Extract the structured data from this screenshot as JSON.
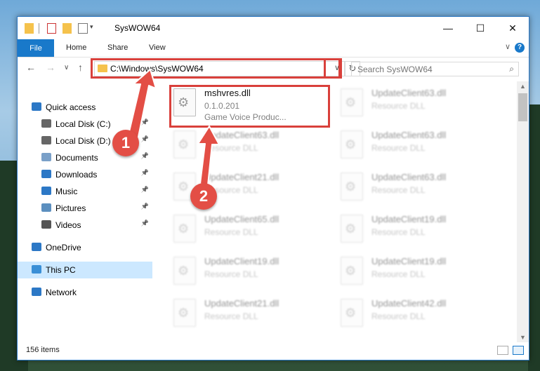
{
  "window": {
    "title": "SysWOW64",
    "controls": {
      "minimize": "—",
      "maximize": "☐",
      "close": "✕"
    }
  },
  "ribbon": {
    "tabs": [
      "File",
      "Home",
      "Share",
      "View"
    ],
    "help": "?",
    "expand": "∨"
  },
  "navigation": {
    "back": "←",
    "forward": "→",
    "recent": "∨",
    "up": "↑",
    "address": "C:\\Windows\\SysWOW64",
    "refresh": "↻",
    "search_placeholder": "Search SysWOW64"
  },
  "sidebar": {
    "items": [
      {
        "label": "Quick access",
        "pinned": false,
        "icon": "star-icon"
      },
      {
        "label": "Local Disk (C:)",
        "pinned": true,
        "icon": "drive-icon"
      },
      {
        "label": "Local Disk (D:)",
        "pinned": true,
        "icon": "drive-icon"
      },
      {
        "label": "Documents",
        "pinned": true,
        "icon": "documents-icon"
      },
      {
        "label": "Downloads",
        "pinned": true,
        "icon": "download-icon"
      },
      {
        "label": "Music",
        "pinned": true,
        "icon": "music-icon"
      },
      {
        "label": "Pictures",
        "pinned": true,
        "icon": "pictures-icon"
      },
      {
        "label": "Videos",
        "pinned": true,
        "icon": "videos-icon"
      },
      {
        "label": "OneDrive",
        "pinned": false,
        "icon": "cloud-icon"
      },
      {
        "label": "This PC",
        "pinned": false,
        "icon": "computer-icon",
        "selected": true
      },
      {
        "label": "Network",
        "pinned": false,
        "icon": "network-icon"
      }
    ]
  },
  "files": [
    {
      "name": "mshvres.dll",
      "line2": "0.1.0.201",
      "line3": "Game Voice   Produc...",
      "highlighted": true
    },
    {
      "name": "UpdateClient63.dll",
      "line2": "Resource DLL"
    },
    {
      "name": "UpdateClient63.dll",
      "line2": "Resource DLL"
    },
    {
      "name": "UpdateClient63.dll",
      "line2": "Resource DLL"
    },
    {
      "name": "UpdateClient21.dll",
      "line2": "Resource DLL"
    },
    {
      "name": "UpdateClient63.dll",
      "line2": "Resource DLL"
    },
    {
      "name": "UpdateClient65.dll",
      "line2": "Resource DLL"
    },
    {
      "name": "UpdateClient19.dll",
      "line2": "Resource DLL"
    },
    {
      "name": "UpdateClient19.dll",
      "line2": "Resource DLL"
    },
    {
      "name": "UpdateClient19.dll",
      "line2": "Resource DLL"
    },
    {
      "name": "UpdateClient21.dll",
      "line2": "Resource DLL"
    },
    {
      "name": "UpdateClient42.dll",
      "line2": "Resource DLL"
    }
  ],
  "status": {
    "item_count": "156 items"
  },
  "annotations": {
    "callout_1": "1",
    "callout_2": "2"
  },
  "colors": {
    "accent": "#1979ca",
    "annotation": "#e34e45",
    "selection": "#cce8ff"
  }
}
